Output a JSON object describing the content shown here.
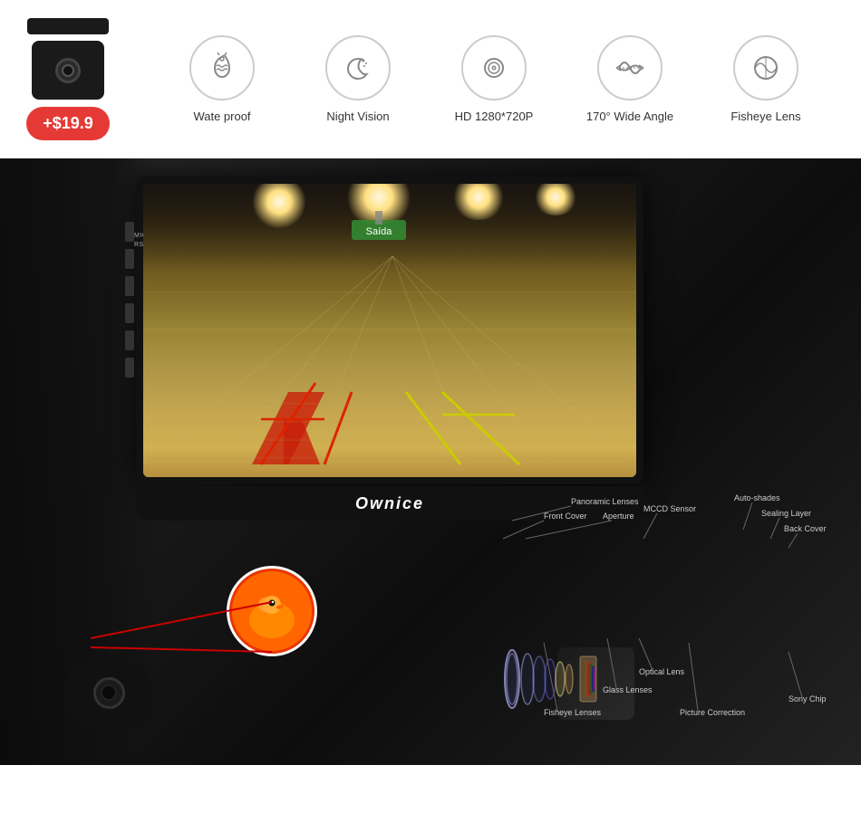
{
  "top": {
    "price": "+$19.9",
    "features": [
      {
        "id": "waterproof",
        "label": "Wate proof",
        "icon": "🌧"
      },
      {
        "id": "night-vision",
        "label": "Night Vision",
        "icon": "🌙"
      },
      {
        "id": "hd",
        "label": "HD 1280*720P",
        "icon": "👁"
      },
      {
        "id": "wide-angle",
        "label": "170° Wide Angle",
        "icon": "📡"
      },
      {
        "id": "fisheye",
        "label": "Fisheye Lens",
        "icon": "⬤"
      }
    ]
  },
  "monitor": {
    "brand": "Ownice",
    "mic_label": "MIC",
    "rst_label": "RST"
  },
  "diagram": {
    "labels": [
      "Panoramic Lenses",
      "Front Cover",
      "Aperture",
      "MCCD Sensor",
      "Auto-shades",
      "Sealing Layer",
      "Back Cover",
      "Optical Lens",
      "Glass Lenses",
      "Fisheye Lenses",
      "Picture Correction",
      "Sony Chip"
    ]
  }
}
